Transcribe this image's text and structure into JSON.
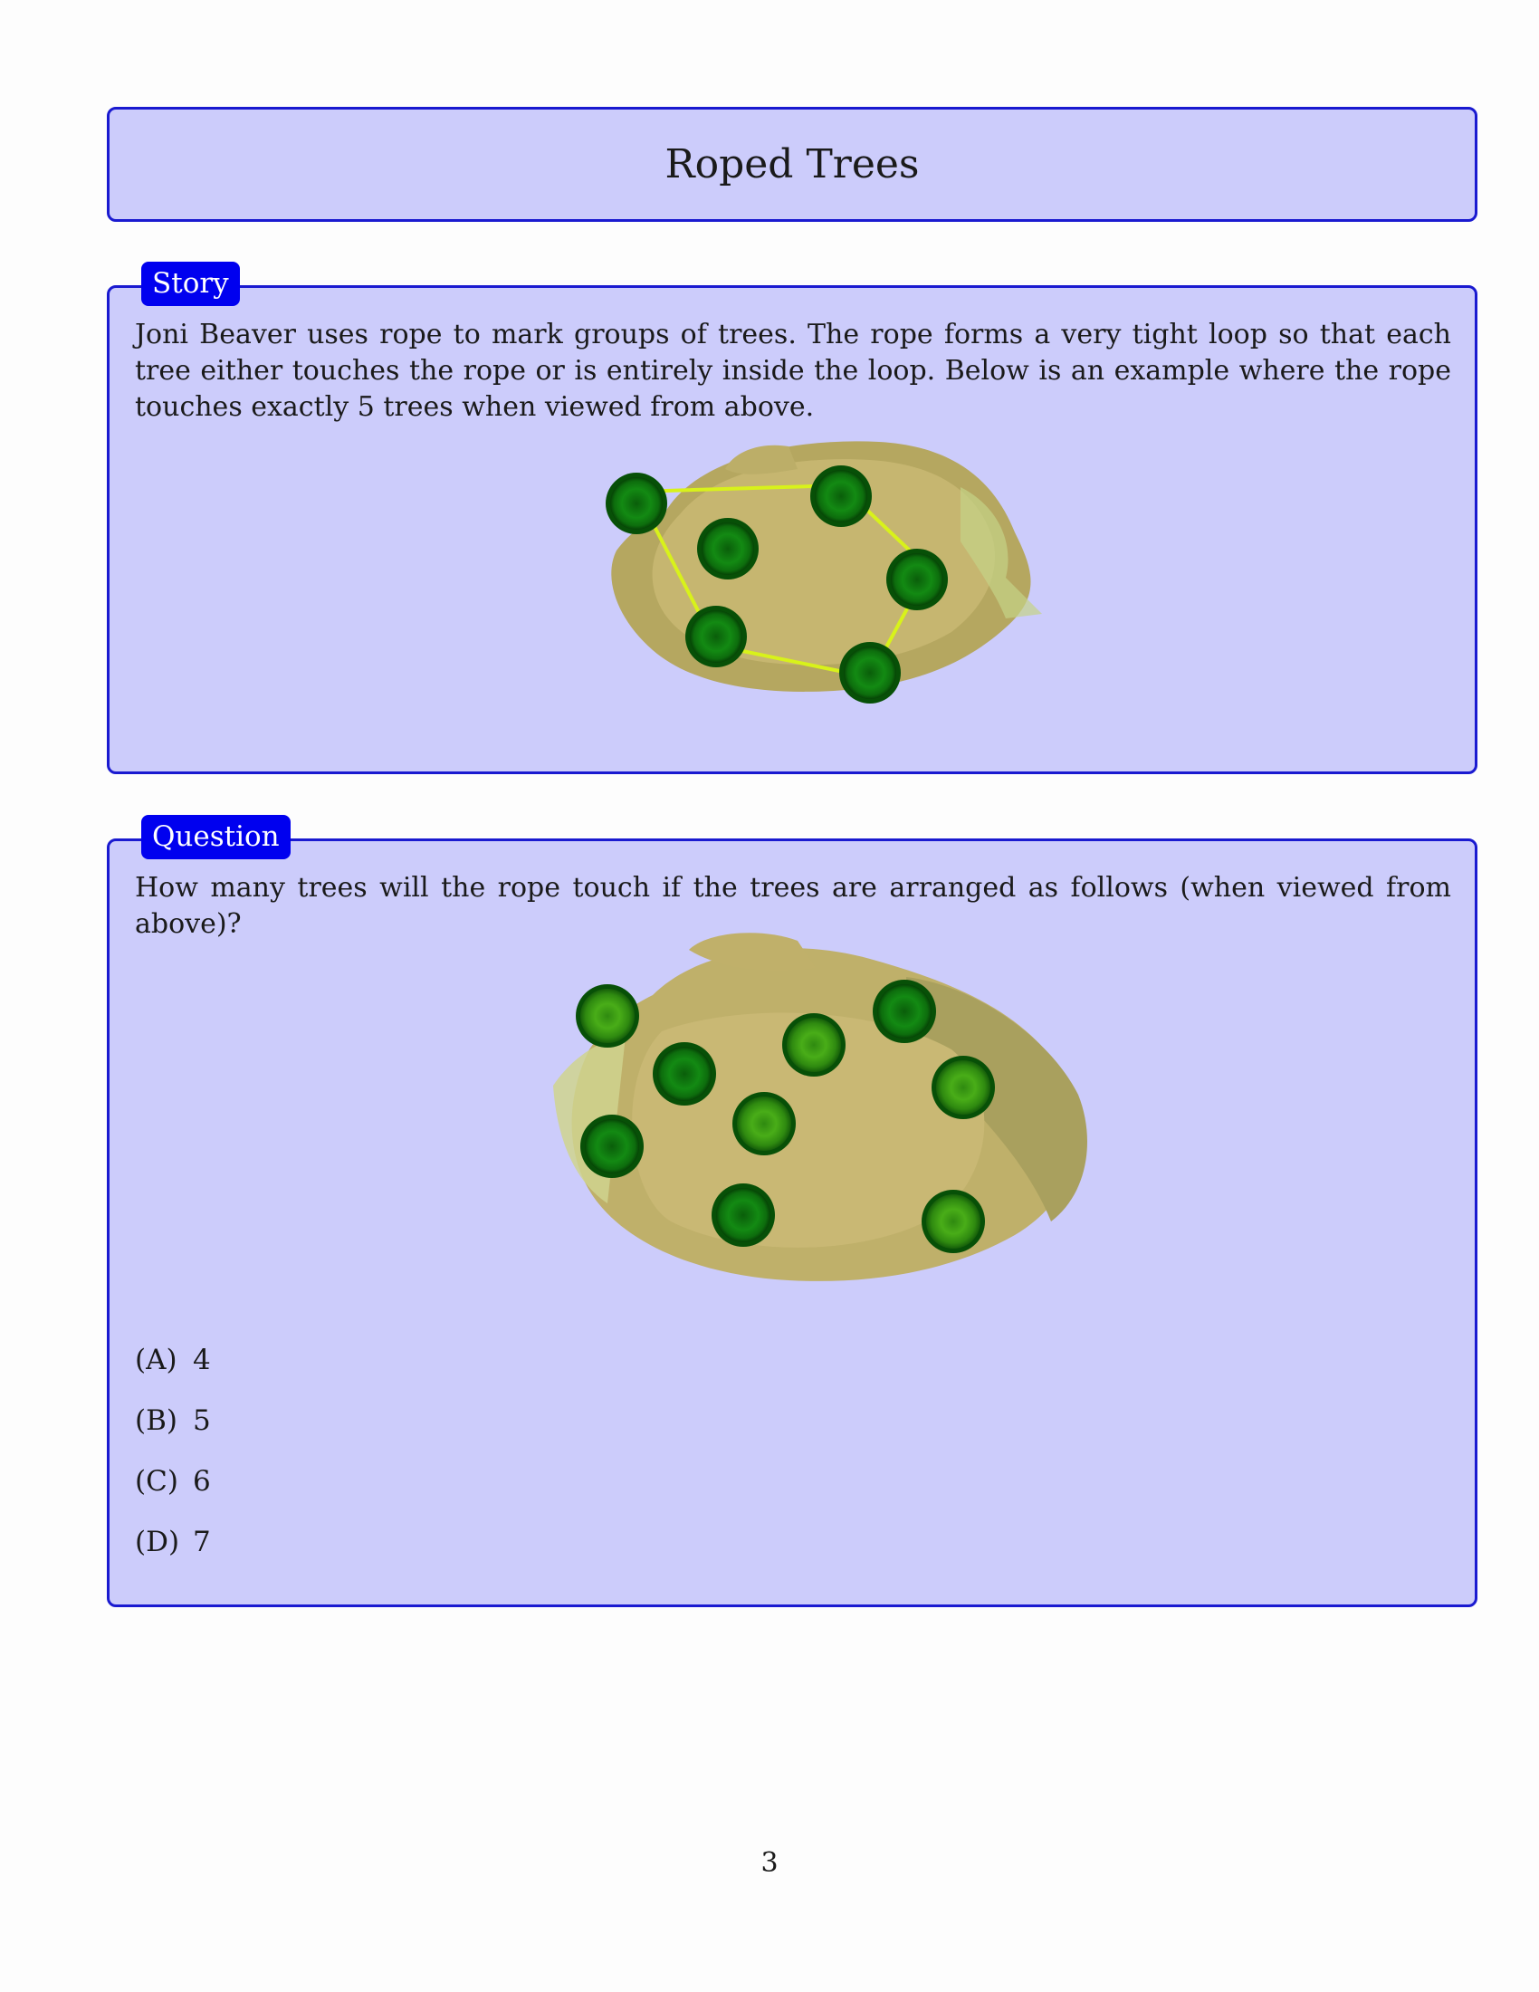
{
  "title": "Roped Trees",
  "story": {
    "label": "Story",
    "text": "Joni Beaver uses rope to mark groups of trees. The rope forms a very tight loop so that each tree either touches the rope or is entirely inside the loop. Below is an example where the rope touches exactly 5 trees when viewed from above."
  },
  "question": {
    "label": "Question",
    "text": "How many trees will the rope touch if the trees are arranged as follows (when viewed from above)?",
    "options": [
      {
        "letter": "(A)",
        "value": "4"
      },
      {
        "letter": "(B)",
        "value": "5"
      },
      {
        "letter": "(C)",
        "value": "6"
      },
      {
        "letter": "(D)",
        "value": "7"
      }
    ]
  },
  "page_number": "3",
  "colors": {
    "box_fill": "#ccccfb",
    "box_border": "#1a1ad0",
    "tab_fill": "#0000ef",
    "ground": "#c3b36e",
    "tree_dark": "#0d6a0d",
    "tree_light": "#3fa514",
    "rope": "#d8f21a"
  }
}
